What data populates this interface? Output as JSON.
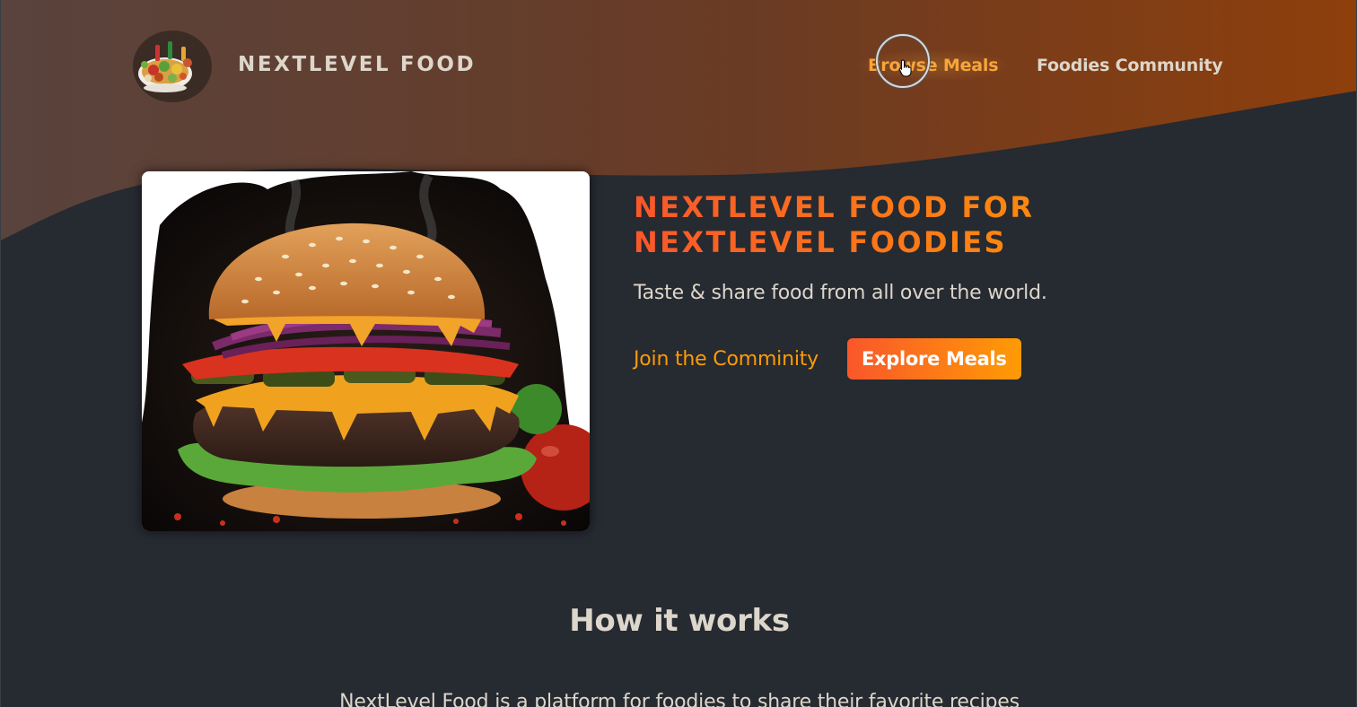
{
  "header": {
    "logo_text": "NextLevel Food",
    "nav": [
      {
        "label": "Browse Meals",
        "active": true
      },
      {
        "label": "Foodies Community",
        "active": false
      }
    ]
  },
  "hero": {
    "title_line1": "NextLevel Food for",
    "title_line2": "NextLevel Foodies",
    "subtitle": "Taste & share food from all over the world.",
    "cta_join": "Join the Comminity",
    "cta_explore": "Explore Meals"
  },
  "how": {
    "title": "How it works",
    "text": "NextLevel Food is a platform for foodies to share their favorite recipes"
  },
  "colors": {
    "accent_start": "#f9572a",
    "accent_end": "#ff9b05",
    "background": "#262a31",
    "header_brown": "#6b3a1f",
    "text": "#ddd6cb"
  }
}
